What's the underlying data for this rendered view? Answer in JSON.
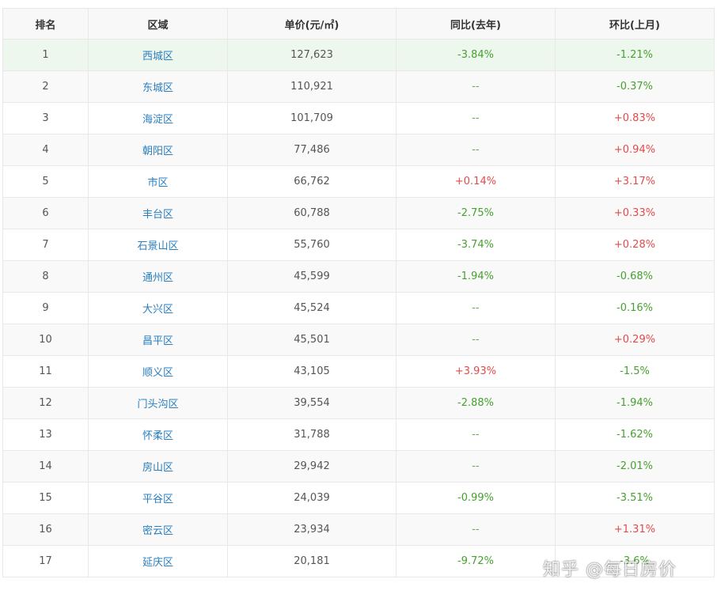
{
  "table": {
    "headers": [
      "排名",
      "区域",
      "单价(元/㎡)",
      "同比(去年)",
      "环比(上月)"
    ],
    "rows": [
      {
        "rank": "1",
        "area": "西城区",
        "price": "127,623",
        "yoy": "-3.84%",
        "mom": "-1.21%"
      },
      {
        "rank": "2",
        "area": "东城区",
        "price": "110,921",
        "yoy": "--",
        "mom": "-0.37%"
      },
      {
        "rank": "3",
        "area": "海淀区",
        "price": "101,709",
        "yoy": "--",
        "mom": "+0.83%"
      },
      {
        "rank": "4",
        "area": "朝阳区",
        "price": "77,486",
        "yoy": "--",
        "mom": "+0.94%"
      },
      {
        "rank": "5",
        "area": "市区",
        "price": "66,762",
        "yoy": "+0.14%",
        "mom": "+3.17%"
      },
      {
        "rank": "6",
        "area": "丰台区",
        "price": "60,788",
        "yoy": "-2.75%",
        "mom": "+0.33%"
      },
      {
        "rank": "7",
        "area": "石景山区",
        "price": "55,760",
        "yoy": "-3.74%",
        "mom": "+0.28%"
      },
      {
        "rank": "8",
        "area": "通州区",
        "price": "45,599",
        "yoy": "-1.94%",
        "mom": "-0.68%"
      },
      {
        "rank": "9",
        "area": "大兴区",
        "price": "45,524",
        "yoy": "--",
        "mom": "-0.16%"
      },
      {
        "rank": "10",
        "area": "昌平区",
        "price": "45,501",
        "yoy": "--",
        "mom": "+0.29%"
      },
      {
        "rank": "11",
        "area": "顺义区",
        "price": "43,105",
        "yoy": "+3.93%",
        "mom": "-1.5%"
      },
      {
        "rank": "12",
        "area": "门头沟区",
        "price": "39,554",
        "yoy": "-2.88%",
        "mom": "-1.94%"
      },
      {
        "rank": "13",
        "area": "怀柔区",
        "price": "31,788",
        "yoy": "--",
        "mom": "-1.62%"
      },
      {
        "rank": "14",
        "area": "房山区",
        "price": "29,942",
        "yoy": "--",
        "mom": "-2.01%"
      },
      {
        "rank": "15",
        "area": "平谷区",
        "price": "24,039",
        "yoy": "-0.99%",
        "mom": "-3.51%"
      },
      {
        "rank": "16",
        "area": "密云区",
        "price": "23,934",
        "yoy": "--",
        "mom": "+1.31%"
      },
      {
        "rank": "17",
        "area": "延庆区",
        "price": "20,181",
        "yoy": "-9.72%",
        "mom": "-3.6%"
      }
    ]
  },
  "colors": {
    "up": "#e34a4a",
    "down": "#45a22e",
    "link": "#2a7fc0",
    "highlight_row": "#eef7ee"
  },
  "watermark": "知乎 @每日房价"
}
